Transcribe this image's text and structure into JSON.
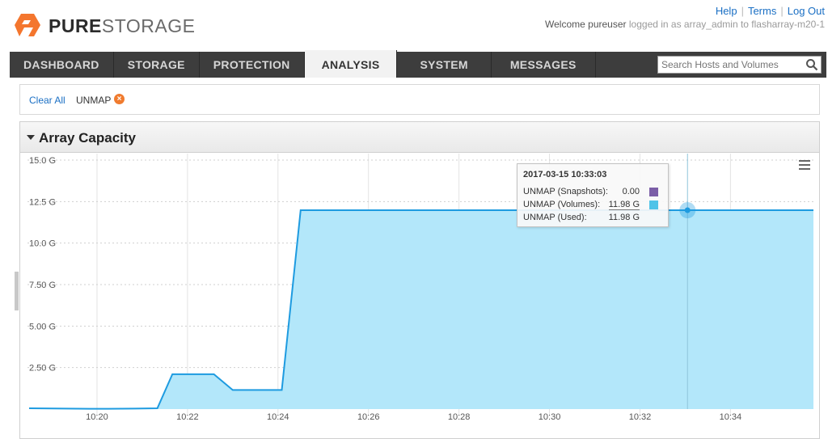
{
  "header": {
    "brand_bold": "PURE",
    "brand_light": "STORAGE",
    "links": [
      "Help",
      "Terms",
      "Log Out"
    ],
    "welcome_prefix": "Welcome",
    "user": "pureuser",
    "logged_in_as": "logged in as array_admin to flasharray-m20-1"
  },
  "nav": {
    "tabs": [
      "DASHBOARD",
      "STORAGE",
      "PROTECTION",
      "ANALYSIS",
      "SYSTEM",
      "MESSAGES"
    ],
    "active": "ANALYSIS",
    "search_placeholder": "Search Hosts and Volumes"
  },
  "filter": {
    "clear_all": "Clear All",
    "chip": "UNMAP"
  },
  "panel": {
    "title": "Array Capacity"
  },
  "tooltip": {
    "time": "2017-03-15 10:33:03",
    "rows": [
      {
        "label": "UNMAP (Snapshots):",
        "value": "0.00",
        "color": "#7b5ea7"
      },
      {
        "label": "UNMAP (Volumes):",
        "value": "11.98 G",
        "color": "#4fc3e8"
      },
      {
        "label": "UNMAP (Used):",
        "value": "11.98 G",
        "color": ""
      }
    ]
  },
  "chart_data": {
    "type": "area",
    "title": "Array Capacity",
    "xlabel": "",
    "ylabel": "",
    "yticks": [
      "15.0 G",
      "12.5 G",
      "10.0 G",
      "7.50 G",
      "5.00 G",
      "2.50 G"
    ],
    "xticks": [
      "10:20",
      "10:22",
      "10:24",
      "10:26",
      "10:28",
      "10:30",
      "10:32",
      "10:34"
    ],
    "ylim": [
      0,
      15
    ],
    "xlim": [
      "10:18:30",
      "10:35:50"
    ],
    "grid": true,
    "fill_color": "#b3e7fa",
    "line_color": "#1e9be0",
    "series": [
      {
        "name": "UNMAP (Volumes)",
        "points": [
          [
            "10:18:30",
            0.05
          ],
          [
            "10:19:50",
            0.02
          ],
          [
            "10:20:15",
            0.02
          ],
          [
            "10:20:50",
            0.03
          ],
          [
            "10:21:20",
            0.05
          ],
          [
            "10:21:40",
            2.1
          ],
          [
            "10:22:10",
            2.1
          ],
          [
            "10:22:35",
            2.1
          ],
          [
            "10:23:00",
            1.15
          ],
          [
            "10:23:40",
            1.15
          ],
          [
            "10:24:05",
            1.15
          ],
          [
            "10:24:30",
            11.98
          ],
          [
            "10:26:00",
            11.98
          ],
          [
            "10:28:00",
            11.98
          ],
          [
            "10:30:00",
            11.98
          ],
          [
            "10:32:00",
            11.98
          ],
          [
            "10:33:03",
            11.98
          ],
          [
            "10:34:00",
            11.98
          ],
          [
            "10:35:50",
            11.98
          ]
        ]
      }
    ],
    "highlight": {
      "x": "10:33:03",
      "y": 11.98
    }
  }
}
